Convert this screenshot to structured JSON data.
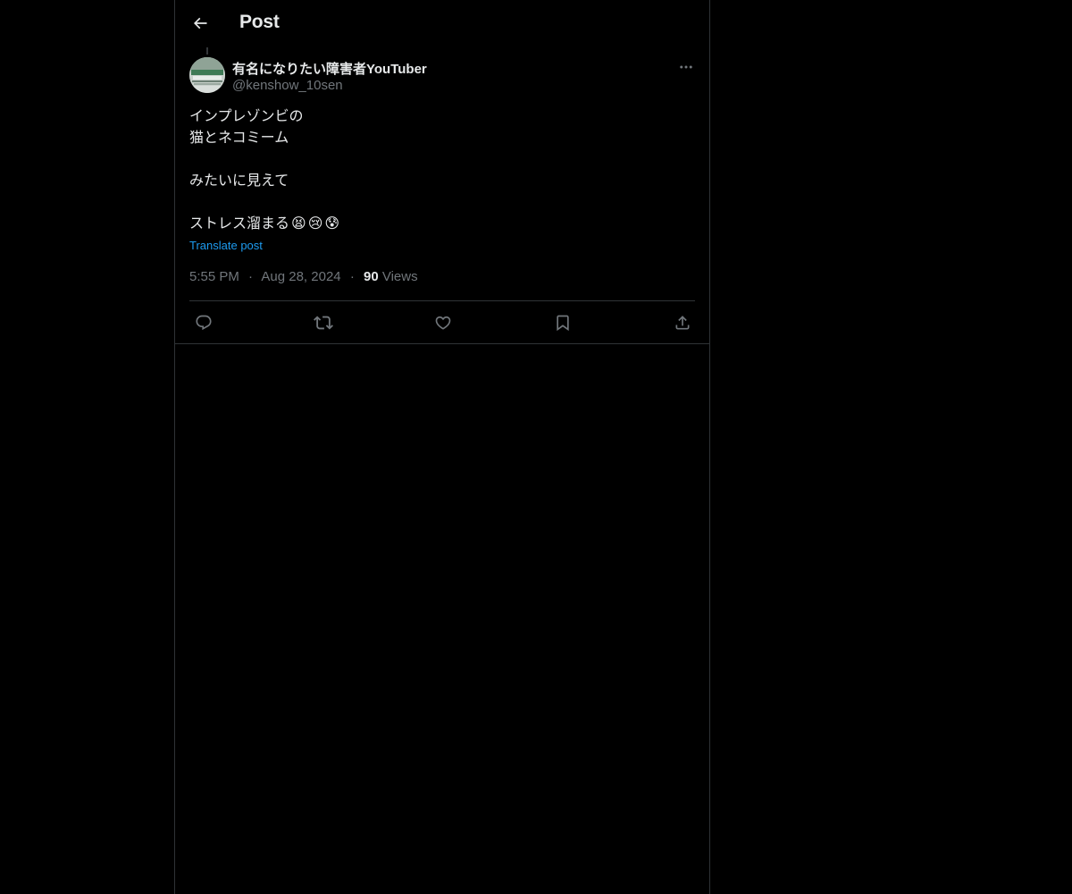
{
  "header": {
    "title": "Post",
    "back_icon": "arrow-left-icon"
  },
  "author": {
    "display_name": "有名になりたい障害者YouTuber",
    "handle": "@kenshow_10sen"
  },
  "post": {
    "lines": [
      "インプレゾンビの",
      "猫とネコミーム",
      "",
      "みたいに見えて",
      "",
      "ストレス溜まる"
    ],
    "emojis": [
      "😫",
      "😢",
      "😰"
    ],
    "translate_label": "Translate post",
    "time": "5:55 PM",
    "separator": "·",
    "date": "Aug 28, 2024",
    "views_count": "90",
    "views_label": "Views"
  },
  "actions": [
    {
      "name": "reply",
      "icon": "reply-icon"
    },
    {
      "name": "repost",
      "icon": "repost-icon"
    },
    {
      "name": "like",
      "icon": "heart-icon"
    },
    {
      "name": "bookmark",
      "icon": "bookmark-icon"
    },
    {
      "name": "share",
      "icon": "share-icon"
    }
  ],
  "colors": {
    "background": "#000000",
    "text": "#e7e9ea",
    "secondary": "#71767b",
    "link": "#1d9bf0",
    "border": "#2f3336"
  }
}
